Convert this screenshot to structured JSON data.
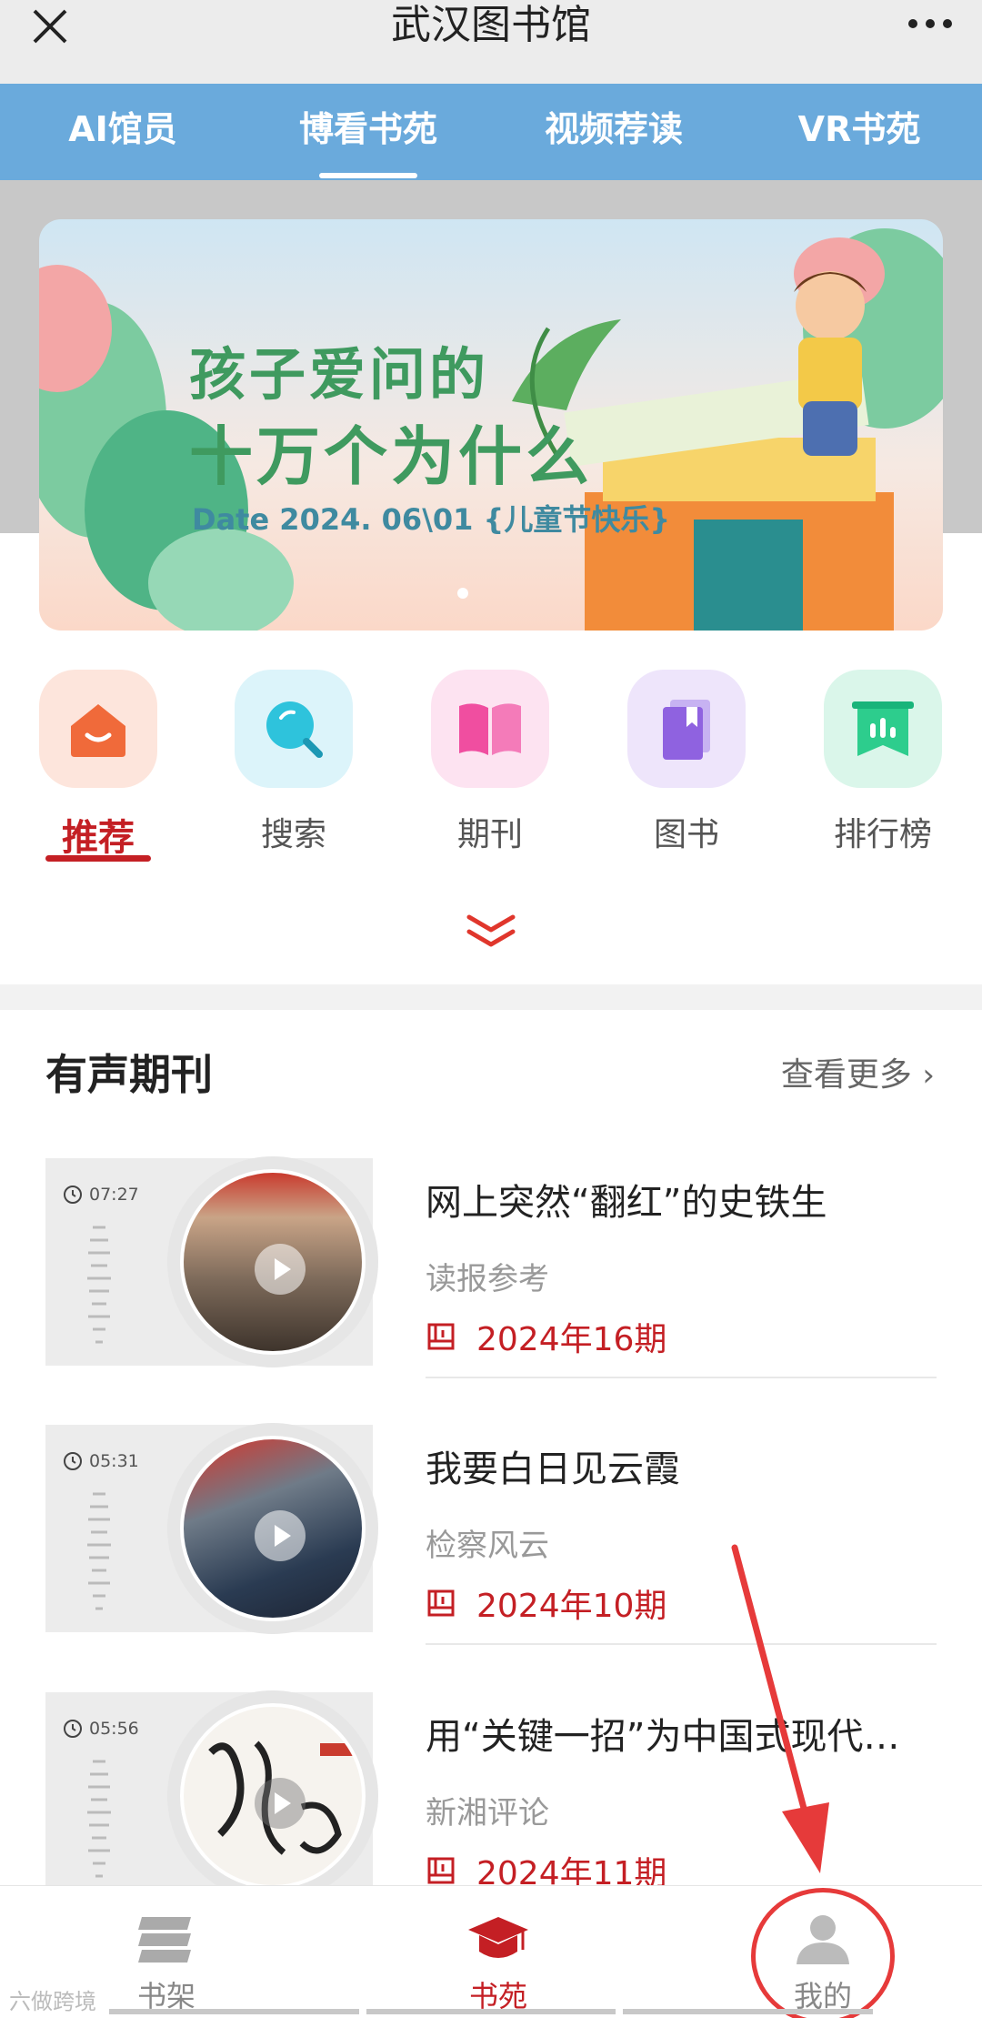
{
  "app": {
    "title": "武汉图书馆"
  },
  "tabs": [
    {
      "label": "AI馆员",
      "active": false
    },
    {
      "label": "博看书苑",
      "active": true
    },
    {
      "label": "视频荐读",
      "active": false
    },
    {
      "label": "VR书苑",
      "active": false
    }
  ],
  "banner": {
    "title_line1": "孩子爱问的",
    "title_line2": "十万个为什么",
    "date_text": "Date 2024. 06\\01 {儿童节快乐}"
  },
  "categories": [
    {
      "label": "推荐",
      "icon": "home-icon",
      "active": true
    },
    {
      "label": "搜索",
      "icon": "search-icon",
      "active": false
    },
    {
      "label": "期刊",
      "icon": "magazine-icon",
      "active": false
    },
    {
      "label": "图书",
      "icon": "book-icon",
      "active": false
    },
    {
      "label": "排行榜",
      "icon": "ranking-icon",
      "active": false
    }
  ],
  "section": {
    "title": "有声期刊",
    "see_more": "查看更多"
  },
  "items": [
    {
      "duration": "07:27",
      "title": "网上突然“翻红”的史铁生",
      "source": "读报参考",
      "issue": "2024年16期"
    },
    {
      "duration": "05:31",
      "title": "我要白日见云霞",
      "source": "检察风云",
      "issue": "2024年10期"
    },
    {
      "duration": "05:56",
      "title": "用“关键一招”为中国式现代…",
      "source": "新湘评论",
      "issue": "2024年11期"
    }
  ],
  "bottom_nav": [
    {
      "label": "书架",
      "icon": "bookshelf-icon",
      "active": false
    },
    {
      "label": "书苑",
      "icon": "graduation-cap-icon",
      "active": true
    },
    {
      "label": "我的",
      "icon": "user-icon",
      "active": false
    }
  ],
  "watermark": "六做跨境",
  "colors": {
    "accent": "#c41f24",
    "tabbar": "#6aaadc"
  }
}
